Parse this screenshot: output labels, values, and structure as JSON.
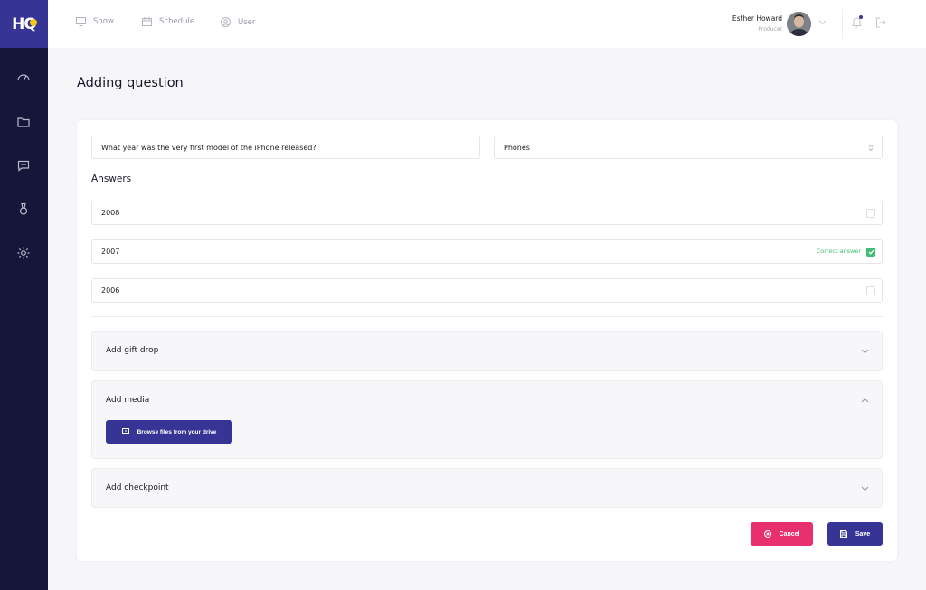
{
  "brand": {
    "logo_text": "HQ",
    "accent": "#363596",
    "sidebar_bg": "#16163a",
    "logo_dot": "#f6c51a"
  },
  "sidebar": {
    "items": [
      {
        "icon": "gauge-icon"
      },
      {
        "icon": "folder-icon"
      },
      {
        "icon": "chat-icon"
      },
      {
        "icon": "trophy-icon"
      },
      {
        "icon": "gear-icon"
      }
    ]
  },
  "topnav": {
    "items": [
      {
        "label": "Show",
        "icon": "monitor-icon"
      },
      {
        "label": "Schedule",
        "icon": "calendar-icon"
      },
      {
        "label": "User",
        "icon": "user-icon"
      }
    ]
  },
  "user": {
    "name": "Esther Howard",
    "role": "Producer"
  },
  "page": {
    "title": "Adding question"
  },
  "form": {
    "question_value": "What year was the very first model of the iPhone released?",
    "category_value": "Phones",
    "answers_title": "Answers",
    "answers": [
      {
        "text": "2008",
        "correct": false
      },
      {
        "text": "2007",
        "correct": true
      },
      {
        "text": "2006",
        "correct": false
      }
    ],
    "correct_label": "Correct answer"
  },
  "sections": {
    "gift_drop": {
      "title": "Add gift drop",
      "expanded": false
    },
    "media": {
      "title": "Add media",
      "expanded": true,
      "browse_label": "Browse files from your drive"
    },
    "checkpoint": {
      "title": "Add checkpoint",
      "expanded": false
    }
  },
  "actions": {
    "cancel_label": "Cancel",
    "save_label": "Save",
    "cancel_color": "#e8306f",
    "save_color": "#363596"
  },
  "status_colors": {
    "correct": "#3fbe74"
  }
}
